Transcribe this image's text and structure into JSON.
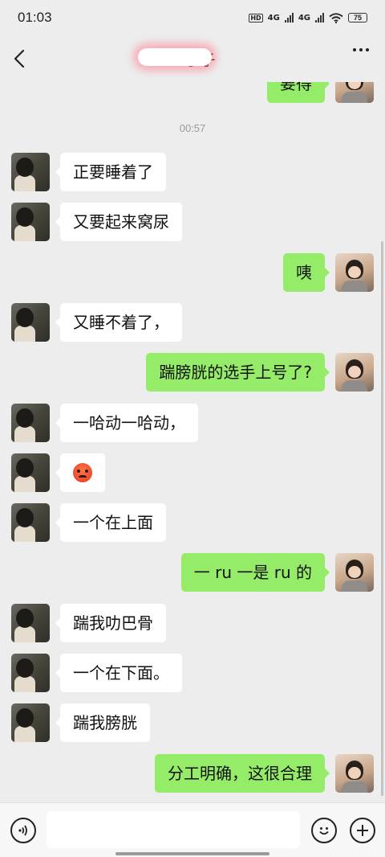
{
  "status_bar": {
    "time": "01:03",
    "hd_label": "HD",
    "network_1": "4G",
    "network_2": "4G",
    "battery": "75"
  },
  "header": {
    "title": "二了子",
    "back_icon": "chevron-left-icon",
    "more_icon": "more-dots-icon"
  },
  "chat": {
    "partial_top_message": "要得",
    "timestamp": "00:57",
    "messages": [
      {
        "side": "left",
        "text": "正要睡着了"
      },
      {
        "side": "left",
        "text": "又要起来窝尿"
      },
      {
        "side": "right",
        "text": "咦"
      },
      {
        "side": "left",
        "text": "又睡不着了，"
      },
      {
        "side": "right",
        "text": "踹膀胱的选手上号了?"
      },
      {
        "side": "left",
        "text": "一哈动一哈动，"
      },
      {
        "side": "left",
        "text": "",
        "emoji": "angry-face-emoji"
      },
      {
        "side": "left",
        "text": "一个在上面"
      },
      {
        "side": "right",
        "text": "一 ru 一是 ru 的"
      },
      {
        "side": "left",
        "text": "踹我叻巴骨"
      },
      {
        "side": "left",
        "text": "一个在下面。"
      },
      {
        "side": "left",
        "text": "踹我膀胱"
      },
      {
        "side": "right",
        "text": "分工明确，这很合理"
      }
    ]
  },
  "input_bar": {
    "voice_icon": "voice-icon",
    "emoji_icon": "emoji-icon",
    "plus_icon": "plus-icon",
    "input_value": ""
  },
  "colors": {
    "background": "#ededed",
    "sent_bubble": "#95ec69",
    "received_bubble": "#ffffff"
  }
}
